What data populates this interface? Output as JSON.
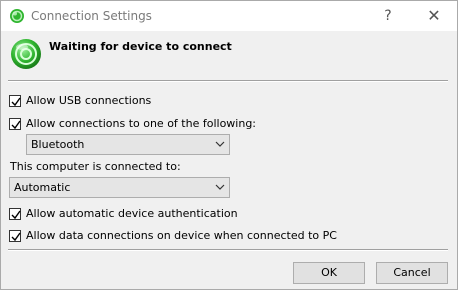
{
  "window": {
    "title": "Connection Settings",
    "help_glyph": "?",
    "close_glyph": "✕"
  },
  "header": {
    "message": "Waiting for device to connect",
    "icon": "green-sync-orb-icon"
  },
  "options": {
    "allow_usb": {
      "label": "Allow USB connections",
      "checked": true
    },
    "allow_one_of": {
      "label": "Allow connections to one of the following:",
      "checked": true
    },
    "connection_type": {
      "value": "Bluetooth"
    },
    "connected_to_label": "This computer is connected to:",
    "connected_to": {
      "value": "Automatic"
    },
    "auto_auth": {
      "label": "Allow automatic device authentication",
      "checked": true
    },
    "data_connections": {
      "label": "Allow data connections on device when connected to PC",
      "checked": true
    }
  },
  "buttons": {
    "ok": "OK",
    "cancel": "Cancel"
  },
  "colors": {
    "accent_green": "#2fb52f",
    "dialog_bg": "#f0f0f0",
    "button_bg": "#e1e1e1"
  }
}
